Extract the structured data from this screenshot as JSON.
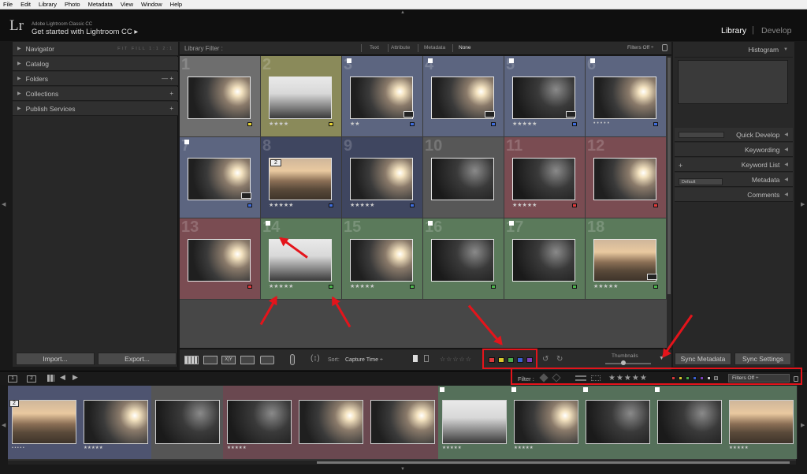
{
  "menu": [
    "File",
    "Edit",
    "Library",
    "Photo",
    "Metadata",
    "View",
    "Window",
    "Help"
  ],
  "identity": {
    "logo": "Lr",
    "app_name": "Adobe Lightroom Classic CC",
    "get_started": "Get started with Lightroom CC ▸"
  },
  "modules": {
    "library": "Library",
    "separator": "|",
    "develop": "Develop"
  },
  "left_panel": {
    "navigator": "Navigator",
    "nav_modes": "FIT  FILL  1:1  2:1",
    "catalog": "Catalog",
    "folders": "Folders",
    "folders_ops": "— +",
    "collections": "Collections",
    "collections_ops": "+",
    "publish": "Publish Services",
    "publish_ops": "+",
    "import": "Import...",
    "export": "Export..."
  },
  "right_panel": {
    "histogram": "Histogram",
    "quick_develop": "Quick Develop",
    "keywording": "Keywording",
    "keyword_list": "Keyword List",
    "kl_plus": "+",
    "metadata": "Metadata",
    "metadata_preset": "Default",
    "comments": "Comments",
    "sync_metadata": "Sync Metadata",
    "sync_settings": "Sync Settings"
  },
  "library_filter": {
    "label": "Library Filter :",
    "options": [
      "Text",
      "Attribute",
      "Metadata",
      "None"
    ],
    "filters_off": "Filters Off ÷"
  },
  "grid": [
    {
      "n": "1",
      "stars": "",
      "tag": "#e7d333",
      "bg": "#6e6e6e",
      "sky": "sun",
      "flag": false
    },
    {
      "n": "2",
      "stars": "★★★★",
      "tag": "#e7d333",
      "bg": "#8a8a5a",
      "sky": "haze",
      "flag": false
    },
    {
      "n": "3",
      "stars": "★★",
      "tag": "#3f6ddc",
      "bg": "#5c6580",
      "sky": "sun",
      "flag": true,
      "badge": true
    },
    {
      "n": "4",
      "stars": "",
      "tag": "#3f6ddc",
      "bg": "#5c6580",
      "sky": "sun",
      "flag": true,
      "badge": true
    },
    {
      "n": "5",
      "stars": "★★★★★",
      "tag": "#3f6ddc",
      "bg": "#5c6580",
      "sky": "dark",
      "flag": true,
      "badge": true
    },
    {
      "n": "6",
      "stars": "• • • • •",
      "tag": "#3f6ddc",
      "bg": "#5c6580",
      "sky": "sun",
      "flag": true
    },
    {
      "n": "7",
      "stars": "",
      "tag": "#3f6ddc",
      "bg": "#5c6580",
      "sky": "sun",
      "flag": true,
      "badge": true
    },
    {
      "n": "8",
      "stars": "★★★★★",
      "tag": "#3f6ddc",
      "bg": "#3f4660",
      "sky": "valley",
      "flag": false,
      "stack": "2"
    },
    {
      "n": "9",
      "stars": "★★★★★",
      "tag": "#3f6ddc",
      "bg": "#3f4660",
      "sky": "sun",
      "flag": false
    },
    {
      "n": "10",
      "stars": "",
      "tag": "",
      "bg": "#575757",
      "sky": "dark",
      "flag": false
    },
    {
      "n": "11",
      "stars": "★★★★★",
      "tag": "#e0393b",
      "bg": "#7a4c52",
      "sky": "dark",
      "flag": false
    },
    {
      "n": "12",
      "stars": "",
      "tag": "#e0393b",
      "bg": "#7a4c52",
      "sky": "sun",
      "flag": false
    },
    {
      "n": "13",
      "stars": "",
      "tag": "#e0393b",
      "bg": "#7a4c52",
      "sky": "sun",
      "flag": false
    },
    {
      "n": "14",
      "stars": "★★★★★",
      "tag": "#4bb54b",
      "bg": "#5b7a5b",
      "sky": "haze",
      "flag": true
    },
    {
      "n": "15",
      "stars": "★★★★★",
      "tag": "#4bb54b",
      "bg": "#5b7a5b",
      "sky": "sun",
      "flag": false
    },
    {
      "n": "16",
      "stars": "",
      "tag": "#4bb54b",
      "bg": "#5b7a5b",
      "sky": "dark",
      "flag": true
    },
    {
      "n": "17",
      "stars": "",
      "tag": "#4bb54b",
      "bg": "#5b7a5b",
      "sky": "dark",
      "flag": true
    },
    {
      "n": "18",
      "stars": "★★★★★",
      "tag": "#4bb54b",
      "bg": "#5b7a5b",
      "sky": "valley",
      "flag": false,
      "badge": true
    }
  ],
  "toolbar": {
    "sort_label": "Sort:",
    "sort_value": "Capture Time ÷",
    "stars": "☆☆☆☆☆",
    "thumbnails": "Thumbnails",
    "color_tags": [
      "#d9373a",
      "#d6c72c",
      "#4aab4a",
      "#3a5fd0",
      "#7a3fb8"
    ]
  },
  "filmstrip_bar": {
    "monitor1": "1",
    "monitor2": "2",
    "filter_label": "Filter :",
    "stars": "★★★★★",
    "filters_off": "Filters Off ÷"
  },
  "filmstrip": [
    {
      "stars": "• • • • •",
      "bg": "#4e5470",
      "sky": "valley",
      "stack": "2"
    },
    {
      "stars": "★★★★★",
      "bg": "#4e5470",
      "sky": "sun"
    },
    {
      "stars": "",
      "bg": "#555555",
      "sky": "dark"
    },
    {
      "stars": "★★★★★",
      "bg": "#6a4850",
      "sky": "dark"
    },
    {
      "stars": "",
      "bg": "#6a4850",
      "sky": "sun"
    },
    {
      "stars": "",
      "bg": "#6a4850",
      "sky": "sun"
    },
    {
      "stars": "★★★★★",
      "bg": "#55705a",
      "sky": "haze",
      "flag": true
    },
    {
      "stars": "★★★★★",
      "bg": "#55705a",
      "sky": "sun",
      "flag": true
    },
    {
      "stars": "",
      "bg": "#55705a",
      "sky": "dark",
      "flag": true
    },
    {
      "stars": "",
      "bg": "#55705a",
      "sky": "dark",
      "flag": true
    },
    {
      "stars": "★★★★★",
      "bg": "#55705a",
      "sky": "valley"
    }
  ],
  "colors": {
    "accent_red": "#e4141b",
    "panel": "#282828",
    "grid_bg": "#474747"
  }
}
